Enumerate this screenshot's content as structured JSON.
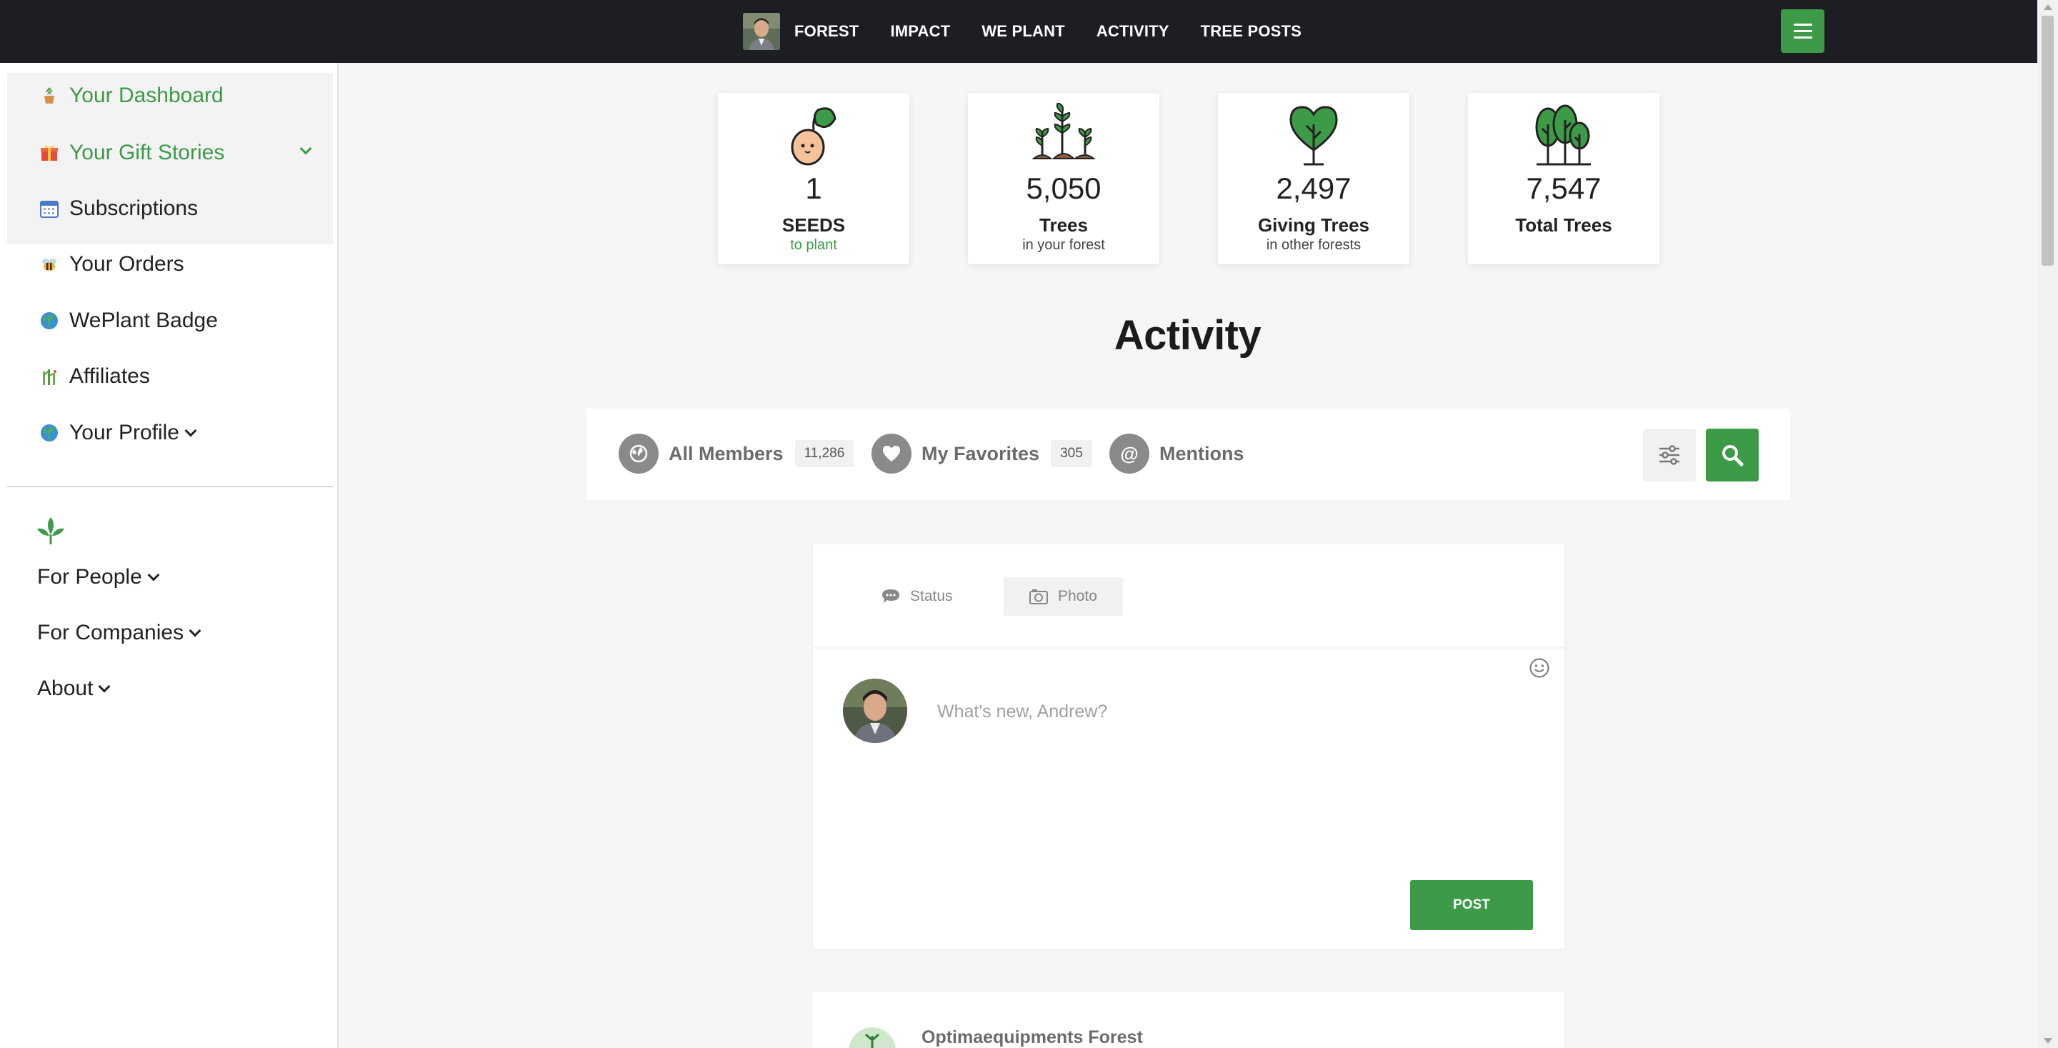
{
  "topnav": {
    "items": [
      "FOREST",
      "IMPACT",
      "WE PLANT",
      "ACTIVITY",
      "TREE POSTS"
    ]
  },
  "sidebar": {
    "items": [
      {
        "label": "Your Dashboard",
        "icon": "potted-plant-icon"
      },
      {
        "label": "Your Gift Stories",
        "icon": "gift-icon"
      },
      {
        "label": "Subscriptions",
        "icon": "calendar-icon"
      },
      {
        "label": "Your Orders",
        "icon": "bee-icon"
      },
      {
        "label": "WePlant Badge",
        "icon": "globe-icon"
      },
      {
        "label": "Affiliates",
        "icon": "bamboo-icon"
      },
      {
        "label": "Your Profile",
        "icon": "globe-icon"
      }
    ],
    "links": [
      "For People",
      "For Companies",
      "About"
    ]
  },
  "stats": [
    {
      "value": "1",
      "label": "SEEDS",
      "sub": "to plant"
    },
    {
      "value": "5,050",
      "label": "Trees",
      "sub": "in your forest"
    },
    {
      "value": "2,497",
      "label": "Giving Trees",
      "sub": "in other forests"
    },
    {
      "value": "7,547",
      "label": "Total Trees",
      "sub": ""
    }
  ],
  "page_title": "Activity",
  "filters": [
    {
      "label": "All Members",
      "count": "11,286"
    },
    {
      "label": "My Favorites",
      "count": "305"
    },
    {
      "label": "Mentions",
      "count": ""
    }
  ],
  "post": {
    "tabs": [
      "Status",
      "Photo"
    ],
    "placeholder": "What's new, Andrew?",
    "button": "POST"
  },
  "feed": {
    "first_item_name": "Optimaequipments Forest"
  },
  "colors": {
    "accent": "#3d9a47",
    "topbar": "#1d1d24"
  }
}
